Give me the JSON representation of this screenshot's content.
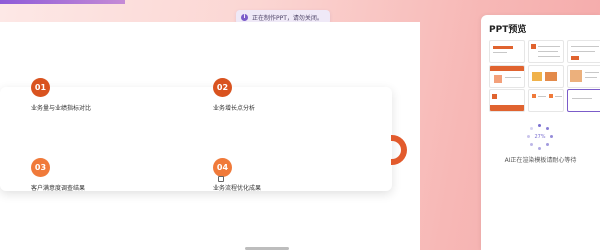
{
  "toast": {
    "text": "正在制作PPT，请勿关闭。",
    "icon": "info-icon"
  },
  "slide": {
    "items": [
      {
        "number": "01",
        "label": "业务量与业绩指标对比",
        "color": "#d9531f"
      },
      {
        "number": "02",
        "label": "业务增长点分析",
        "color": "#d9531f"
      },
      {
        "number": "03",
        "label": "客户满意度调查结果",
        "color": "#f07a3a"
      },
      {
        "number": "04",
        "label": "业务流程优化成果",
        "color": "#f07a3a"
      }
    ]
  },
  "preview": {
    "title": "PPT预览",
    "progress_text": "27%",
    "progress": 0.27,
    "status": "AI正在渲染模板请耐心等待"
  },
  "colors": {
    "accent": "#e25a2c",
    "selection": "#7b5cc9"
  }
}
